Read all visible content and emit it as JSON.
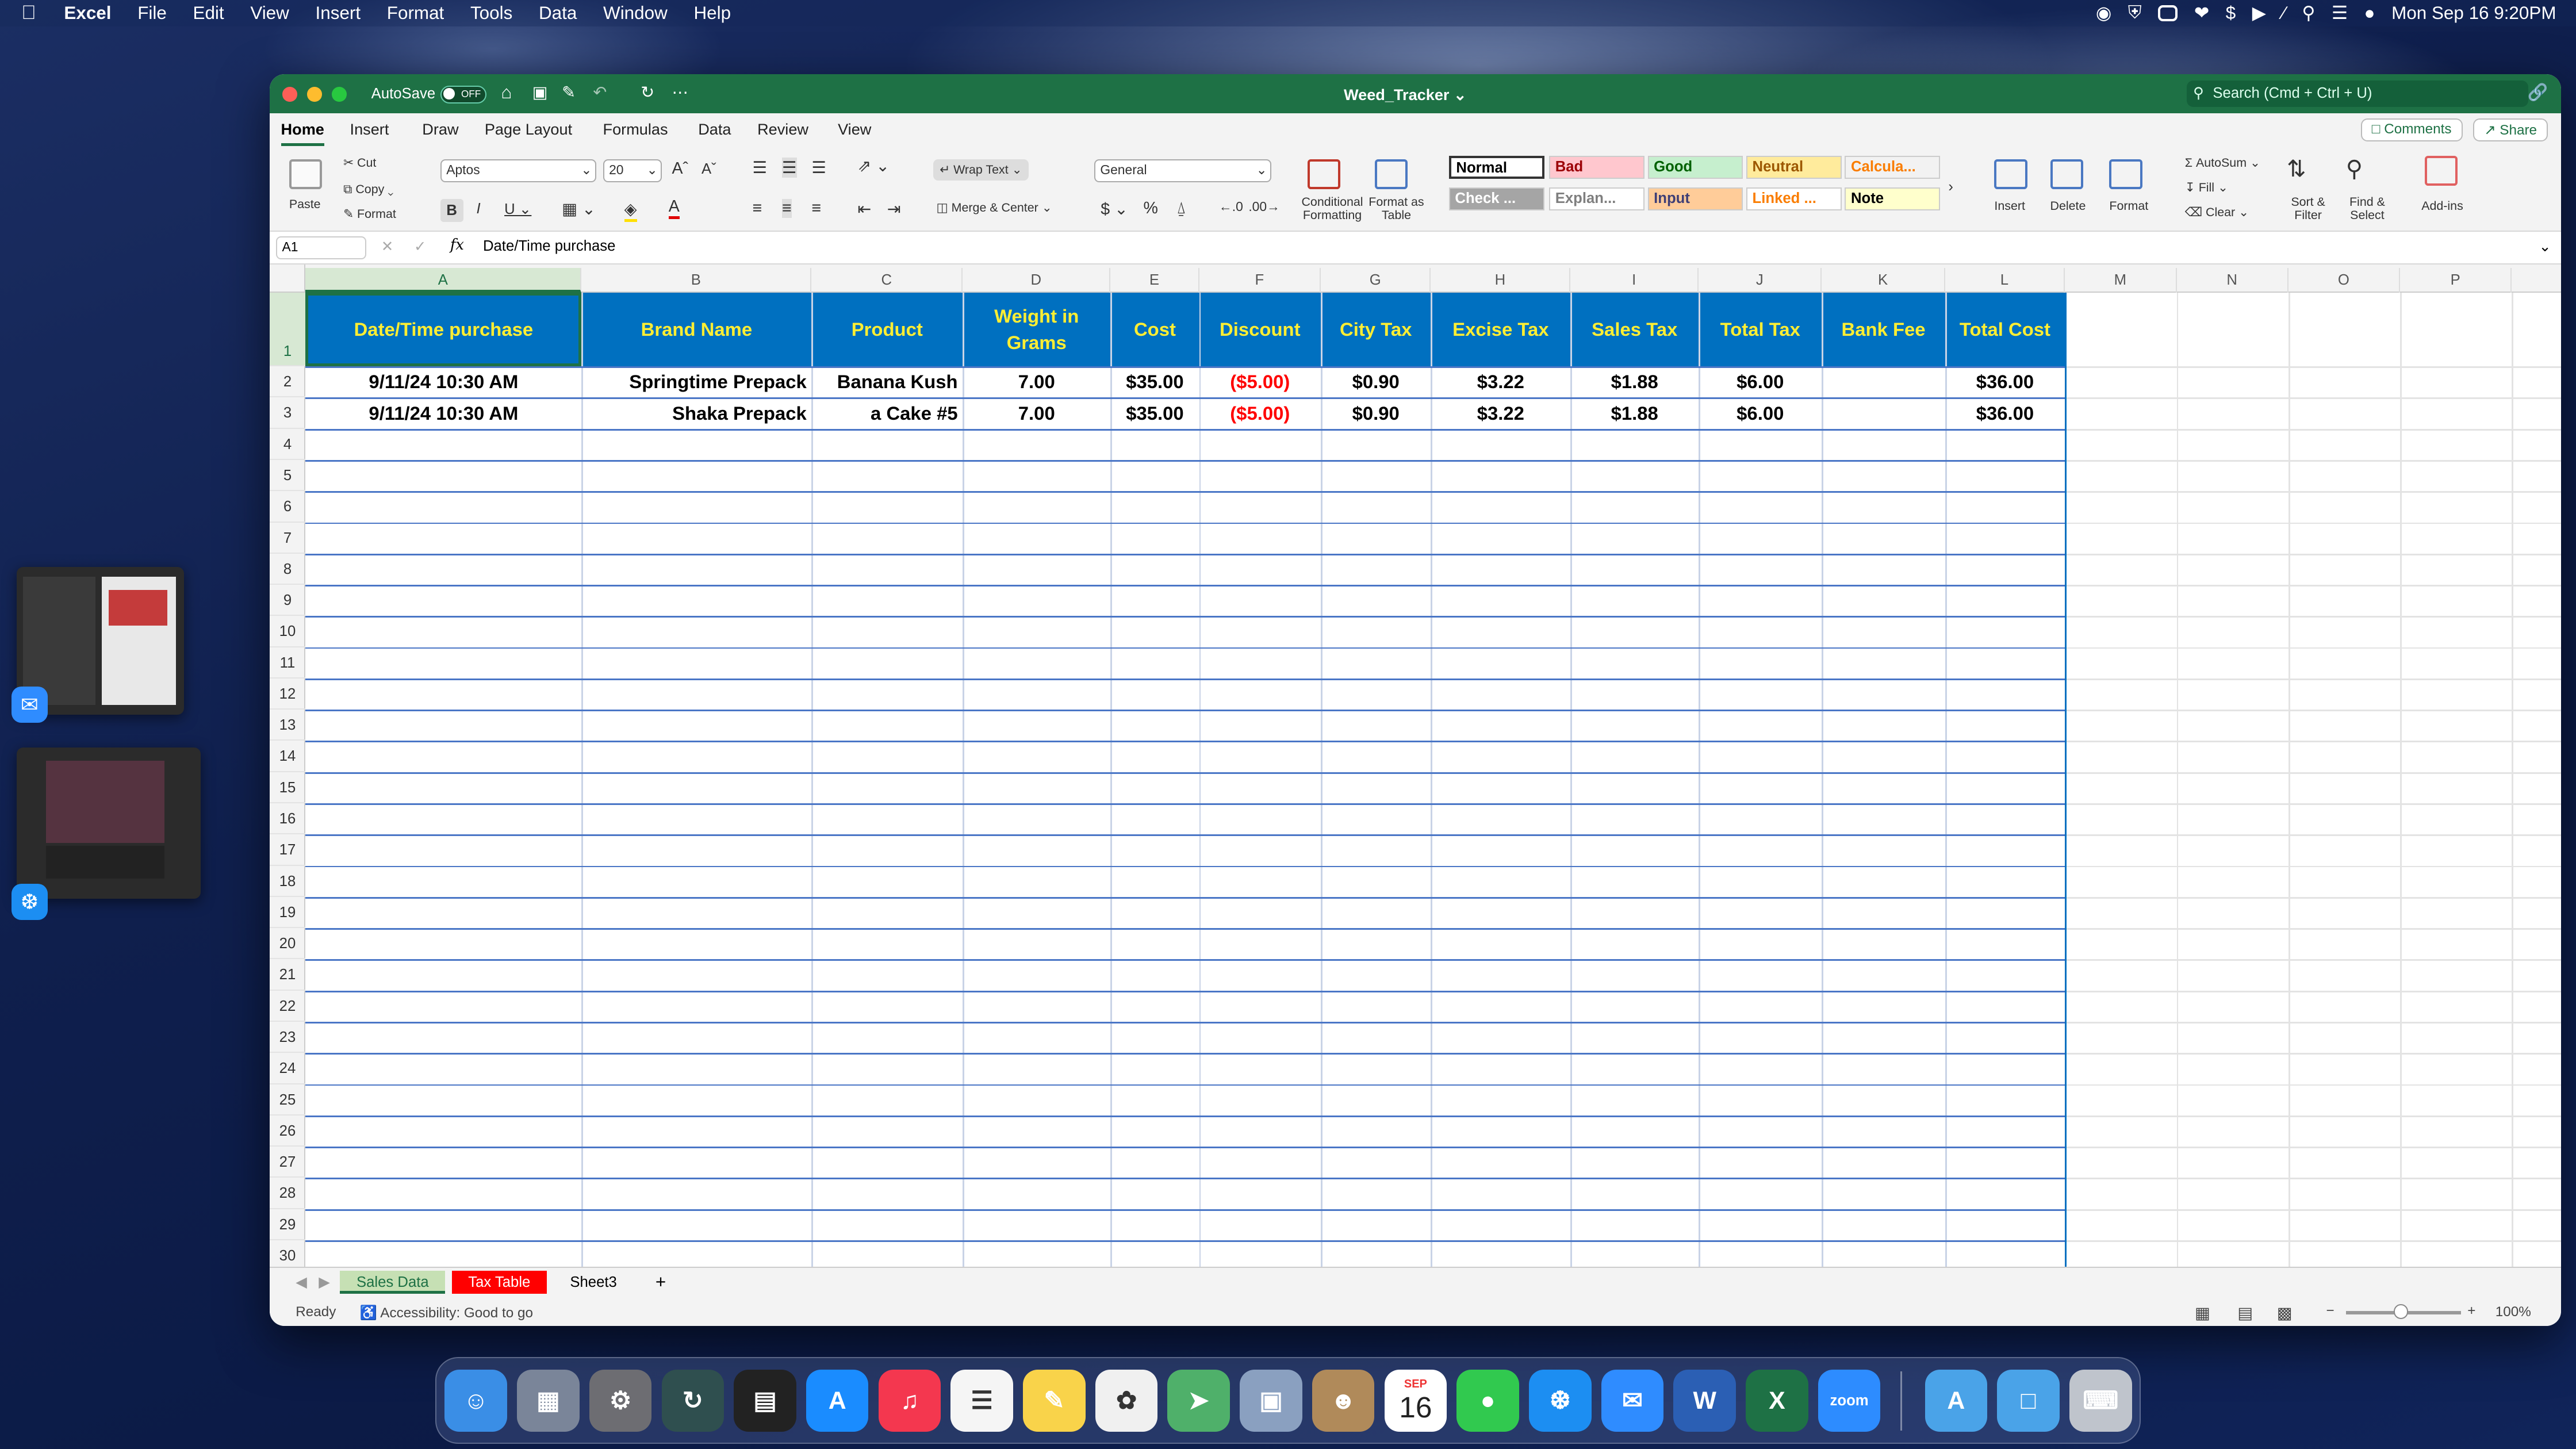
{
  "menubar": {
    "app": "Excel",
    "items": [
      "File",
      "Edit",
      "View",
      "Insert",
      "Format",
      "Tools",
      "Data",
      "Window",
      "Help"
    ],
    "clock": "Mon Sep 16  9:20PM"
  },
  "window": {
    "title": "Weed_Tracker",
    "autosave_label": "AutoSave",
    "autosave_state": "OFF",
    "search_placeholder": "Search (Cmd + Ctrl + U)"
  },
  "ribbon_tabs": [
    "Home",
    "Insert",
    "Draw",
    "Page Layout",
    "Formulas",
    "Data",
    "Review",
    "View"
  ],
  "ribbon_buttons": {
    "comments": "Comments",
    "share": "Share"
  },
  "ribbon": {
    "paste": "Paste",
    "cut": "Cut",
    "copy": "Copy",
    "format_painter": "Format",
    "font": "Aptos",
    "font_size": "20",
    "wrap_text": "Wrap Text",
    "merge": "Merge & Center",
    "number_format": "General",
    "conditional": "Conditional Formatting",
    "format_table": "Format as Table",
    "styles": [
      {
        "label": "Normal",
        "bg": "#ffffff",
        "fg": "#000000"
      },
      {
        "label": "Bad",
        "bg": "#ffc7ce",
        "fg": "#9c0006"
      },
      {
        "label": "Good",
        "bg": "#c6efce",
        "fg": "#006100"
      },
      {
        "label": "Neutral",
        "bg": "#ffeb9c",
        "fg": "#9c5700"
      },
      {
        "label": "Calcula...",
        "bg": "#f2f2f2",
        "fg": "#fa7d00"
      },
      {
        "label": "Check ...",
        "bg": "#a5a5a5",
        "fg": "#ffffff"
      },
      {
        "label": "Explan...",
        "bg": "#ffffff",
        "fg": "#7f7f7f"
      },
      {
        "label": "Input",
        "bg": "#ffcc99",
        "fg": "#3f3f76"
      },
      {
        "label": "Linked ...",
        "bg": "#ffffff",
        "fg": "#fa7d00"
      },
      {
        "label": "Note",
        "bg": "#ffffcc",
        "fg": "#000000"
      }
    ],
    "insert": "Insert",
    "delete": "Delete",
    "format": "Format",
    "autosum": "AutoSum",
    "fill": "Fill",
    "clear": "Clear",
    "sort_filter": "Sort & Filter",
    "find_select": "Find & Select",
    "addins": "Add-ins"
  },
  "formula_bar": {
    "cell_ref": "A1",
    "fx": "fx",
    "content": "Date/Time purchase"
  },
  "columns": [
    "A",
    "B",
    "C",
    "D",
    "E",
    "F",
    "G",
    "H",
    "I",
    "J",
    "K",
    "L",
    "M",
    "N",
    "O",
    "P"
  ],
  "table": {
    "headers": [
      "Date/Time purchase",
      "Brand Name",
      "Product",
      "Weight in Grams",
      "Cost",
      "Discount",
      "City Tax",
      "Excise Tax",
      "Sales Tax",
      "Total Tax",
      "Bank Fee",
      "Total Cost"
    ],
    "rows": [
      [
        "9/11/24 10:30 AM",
        "Springtime Prepack",
        "Banana Kush",
        "7.00",
        "$35.00",
        "($5.00)",
        "$0.90",
        "$3.22",
        "$1.88",
        "$6.00",
        "",
        "$36.00"
      ],
      [
        "9/11/24 10:30 AM",
        "Shaka Prepack",
        "a Cake #5",
        "7.00",
        "$35.00",
        "($5.00)",
        "$0.90",
        "$3.22",
        "$1.88",
        "$6.00",
        "",
        "$36.00"
      ]
    ],
    "header_bg": "#0070c0",
    "header_fg": "#ffee33",
    "negative_color": "#ff0000"
  },
  "row_numbers": [
    "1",
    "2",
    "3",
    "4",
    "5",
    "6",
    "7",
    "8",
    "9",
    "10",
    "11",
    "12",
    "13",
    "14",
    "15",
    "16",
    "17",
    "18",
    "19",
    "20",
    "21",
    "22",
    "23",
    "24",
    "25",
    "26",
    "27",
    "28",
    "29",
    "30"
  ],
  "sheet_tabs": [
    {
      "label": "Sales Data",
      "active": true
    },
    {
      "label": "Tax Table",
      "active": false
    },
    {
      "label": "Sheet3",
      "active": false
    }
  ],
  "status": {
    "ready": "Ready",
    "accessibility": "Accessibility: Good to go",
    "zoom": "100%"
  },
  "dock": {
    "calendar_month": "SEP",
    "calendar_day": "16",
    "zoom_label": "zoom",
    "apps": [
      "finder-icon",
      "launchpad-icon",
      "system-settings-icon",
      "time-machine-icon",
      "activity-monitor-icon",
      "app-store-icon",
      "music-icon",
      "reminders-icon",
      "notes-icon",
      "photos-icon",
      "maps-icon",
      "preview-icon",
      "contacts-icon",
      "calendar-icon",
      "messages-icon",
      "safari-icon",
      "mail-icon",
      "word-icon",
      "excel-icon",
      "zoom-icon",
      "applications-folder-icon",
      "documents-folder-icon",
      "trash-icon"
    ]
  }
}
